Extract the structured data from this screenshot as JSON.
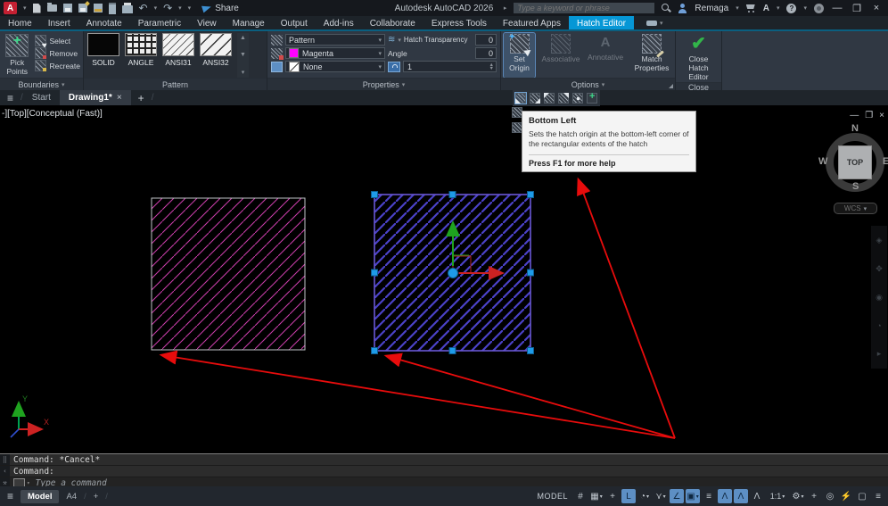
{
  "titlebar": {
    "app_title": "Autodesk AutoCAD 2026",
    "share_label": "Share",
    "search_placeholder": "Type a keyword or phrase",
    "account_name": "Remaga",
    "qat_icons": [
      "autodesk-logo",
      "new-file",
      "open-file",
      "save",
      "save-as",
      "plot",
      "sheet-set",
      "print",
      "undo",
      "redo",
      "qat-customize",
      "share"
    ]
  },
  "ribbon_tabs": [
    {
      "name": "tab-home",
      "label": "Home"
    },
    {
      "name": "tab-insert",
      "label": "Insert"
    },
    {
      "name": "tab-annotate",
      "label": "Annotate"
    },
    {
      "name": "tab-parametric",
      "label": "Parametric"
    },
    {
      "name": "tab-view",
      "label": "View"
    },
    {
      "name": "tab-manage",
      "label": "Manage"
    },
    {
      "name": "tab-output",
      "label": "Output"
    },
    {
      "name": "tab-add-ins",
      "label": "Add-ins"
    },
    {
      "name": "tab-collaborate",
      "label": "Collaborate"
    },
    {
      "name": "tab-express-tools",
      "label": "Express Tools"
    },
    {
      "name": "tab-featured-apps",
      "label": "Featured Apps"
    },
    {
      "name": "tab-hatch-editor",
      "label": "Hatch Editor",
      "active": true
    }
  ],
  "ribbon": {
    "boundaries": {
      "pick_points": "Pick Points",
      "select": "Select",
      "remove": "Remove",
      "recreate": "Recreate",
      "footer": "Boundaries"
    },
    "pattern": {
      "swatches": [
        {
          "label": "SOLID",
          "kind": "solid"
        },
        {
          "label": "ANGLE",
          "kind": "angle"
        },
        {
          "label": "ANSI31",
          "kind": "ansi31"
        },
        {
          "label": "ANSI32",
          "kind": "ansi32"
        }
      ],
      "footer": "Pattern"
    },
    "properties": {
      "pattern_value": "Pattern",
      "transparency_label": "Hatch Transparency",
      "transparency_value": "0",
      "color_value": "Magenta",
      "angle_label": "Angle",
      "angle_value": "0",
      "background_value": "None",
      "scale_value": "1",
      "footer": "Properties"
    },
    "options": {
      "set_origin": "Set Origin",
      "associative": "Associative",
      "annotative": "Annotative",
      "match_properties": "Match Properties",
      "footer": "Options"
    },
    "close": {
      "button_label": "Close Hatch Editor",
      "footer": "Close"
    }
  },
  "origin_flyout": {
    "items": [
      {
        "name": "origin-bottom-left-icon",
        "kind": "bl",
        "hover": true
      },
      {
        "name": "origin-bottom-right-icon",
        "kind": "br"
      },
      {
        "name": "origin-top-left-icon",
        "kind": "tl"
      },
      {
        "name": "origin-top-right-icon",
        "kind": "tr"
      },
      {
        "name": "origin-center-icon",
        "kind": "ct"
      },
      {
        "name": "store-as-default-origin-icon",
        "kind": "st"
      }
    ]
  },
  "origin_flyout_tooltip": {
    "title": "Bottom Left",
    "body": "Sets the hatch origin at the bottom-left corner of the rectangular extents of the hatch",
    "footer": "Press F1 for more help"
  },
  "file_tabs": {
    "start": "Start",
    "drawing": "Drawing1*",
    "close_glyph": "×",
    "new_tab": "+"
  },
  "viewport": {
    "label": "-][Top][Conceptual (Fast)]",
    "viewcube": {
      "n": "N",
      "e": "E",
      "s": "S",
      "w": "W",
      "top": "TOP",
      "wcs": "WCS"
    }
  },
  "command_line": {
    "history": [
      "Command: *Cancel*",
      "Command:"
    ],
    "placeholder": "Type a command"
  },
  "statusbar": {
    "model_tab": "Model",
    "layout_tab": "A4",
    "new_layout_label": "+",
    "model_label": "MODEL",
    "icons": [
      {
        "name": "grid-display-icon",
        "glyph": "#"
      },
      {
        "name": "snap-mode-icon",
        "glyph": "▦",
        "caret": true
      },
      {
        "name": "dynamic-input-icon",
        "glyph": "+"
      },
      {
        "name": "ortho-mode-icon",
        "glyph": "L",
        "on": true
      },
      {
        "name": "polar-tracking-icon",
        "glyph": "◔",
        "caret": true
      },
      {
        "name": "isometric-drafting-icon",
        "glyph": "⋎",
        "caret": true
      },
      {
        "name": "object-snap-tracking-icon",
        "glyph": "∠",
        "on": true
      },
      {
        "name": "object-snap-icon",
        "glyph": "▣",
        "on": true,
        "caret": true
      },
      {
        "name": "lineweight-icon",
        "glyph": "≡"
      },
      {
        "name": "annotation-visibility-icon",
        "glyph": "Λ",
        "on": true
      },
      {
        "name": "annotation-autoscale-icon",
        "glyph": "Λ",
        "on": true
      },
      {
        "name": "annotative-objects-icon",
        "glyph": "Λ"
      },
      {
        "name": "annotation-scale-icon",
        "glyph": "1:1",
        "caret": true,
        "wide": true
      },
      {
        "name": "workspace-switching-icon",
        "glyph": "⚙",
        "caret": true
      },
      {
        "name": "customization-icon",
        "glyph": "+"
      },
      {
        "name": "isolate-objects-icon",
        "glyph": "◎"
      },
      {
        "name": "graphics-performance-icon",
        "glyph": "⚡",
        "warn": true
      },
      {
        "name": "clean-screen-icon",
        "glyph": "▢"
      },
      {
        "name": "customize-menu-icon",
        "glyph": "≡"
      }
    ]
  },
  "colors": {
    "accent_cyan": "#0697d6",
    "hatch_magenta": "#cf3fae",
    "hatch_blue": "#4b42c8",
    "selection_border": "#6a57d6",
    "grip_blue": "#1e9be8",
    "arrow_red": "#e80c0c",
    "magenta_swatch": "#ff00ff",
    "close_check_green": "#32b54a"
  }
}
